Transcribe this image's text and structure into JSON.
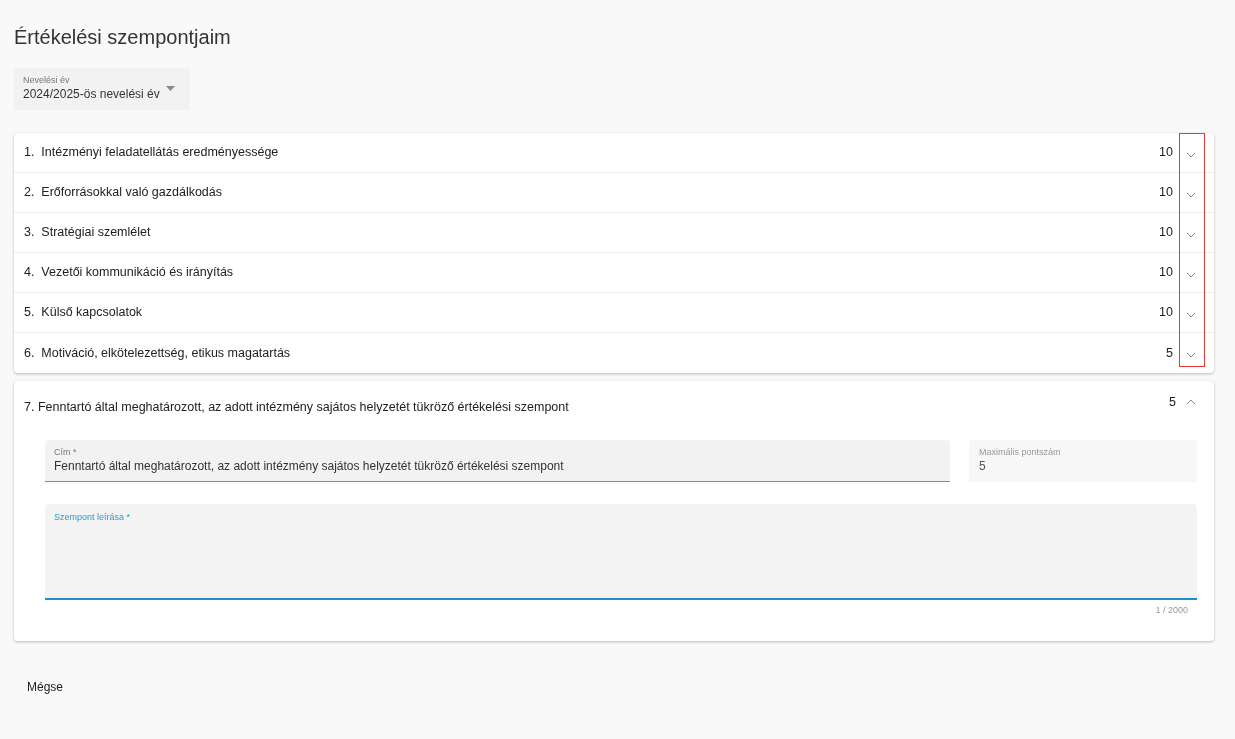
{
  "title": "Értékelési szempontjaim",
  "year_select": {
    "label": "Nevelési év",
    "value": "2024/2025-ös nevelési év"
  },
  "highlight_collapsed_toggles": true,
  "panels": [
    {
      "title": "1.  Intézményi feladatellátás eredményessége",
      "points": "10",
      "expanded": false
    },
    {
      "title": "2.  Erőforrásokkal való gazdálkodás",
      "points": "10",
      "expanded": false
    },
    {
      "title": "3.  Stratégiai szemlélet",
      "points": "10",
      "expanded": false
    },
    {
      "title": "4.  Vezetői kommunikáció és irányítás",
      "points": "10",
      "expanded": false
    },
    {
      "title": "5.  Külső kapcsolatok",
      "points": "10",
      "expanded": false
    },
    {
      "title": "6.  Motiváció, elkötelezettség, etikus magatartás",
      "points": "5",
      "expanded": false
    },
    {
      "title": "7. Fenntartó által meghatározott, az adott intézmény sajátos helyzetét tükröző értékelési szempont",
      "points": "5",
      "expanded": true,
      "form": {
        "title_field": {
          "label": "Cím *",
          "value": "Fenntartó által meghatározott, az adott intézmény sajátos helyzetét tükröző értékelési szempont"
        },
        "max_points_field": {
          "label": "Maximális pontszám",
          "value": "5"
        },
        "description_field": {
          "label": "Szempont leírása *",
          "counter": "1 / 2000"
        }
      }
    }
  ],
  "cancel_button": "Mégse"
}
